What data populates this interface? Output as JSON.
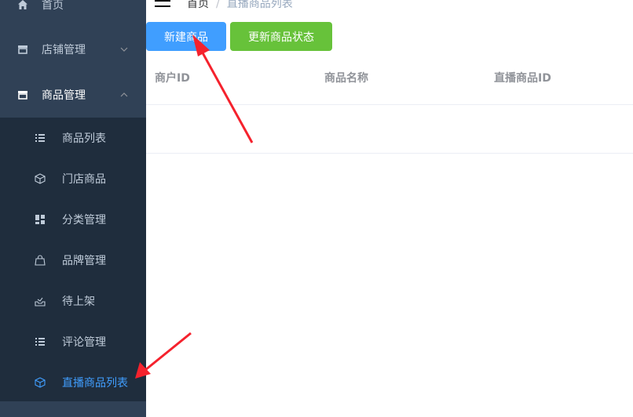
{
  "sidebar": {
    "home": {
      "label": "首页",
      "icon": "home-icon"
    },
    "store": {
      "label": "店铺管理",
      "icon": "store-icon"
    },
    "product": {
      "label": "商品管理",
      "icon": "store-icon"
    },
    "sub_items": [
      {
        "label": "商品列表",
        "icon": "list-icon"
      },
      {
        "label": "门店商品",
        "icon": "box-icon"
      },
      {
        "label": "分类管理",
        "icon": "grid-icon"
      },
      {
        "label": "品牌管理",
        "icon": "bag-icon"
      },
      {
        "label": "待上架",
        "icon": "inbox-icon"
      },
      {
        "label": "评论管理",
        "icon": "list-icon"
      },
      {
        "label": "直播商品列表",
        "icon": "box-icon"
      }
    ],
    "colors": {
      "bg": "#304156",
      "sub_bg": "#1f2d3d",
      "text": "#bfcbd9",
      "active": "#409eff"
    }
  },
  "breadcrumb": {
    "home": "首页",
    "separator": "/",
    "current": "直播商品列表"
  },
  "toolbar": {
    "new_label": "新建商品",
    "update_label": "更新商品状态"
  },
  "table": {
    "headers": [
      "商户ID",
      "商品名称",
      "直播商品ID"
    ]
  },
  "annotation_color": "#f5222d"
}
